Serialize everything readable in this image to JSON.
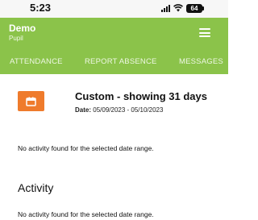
{
  "status_bar": {
    "time": "5:23",
    "battery": "64"
  },
  "header": {
    "title": "Demo",
    "subtitle": "Pupil",
    "menu_icon": "hamburger-menu-icon",
    "background_color": "#8bc34a"
  },
  "tabs": [
    {
      "label": "ATTENDANCE"
    },
    {
      "label": "REPORT ABSENCE"
    },
    {
      "label": "MESSAGES"
    }
  ],
  "date_range": {
    "icon": "calendar-icon",
    "button_color": "#ef7b2c",
    "title": "Custom - showing 31 days",
    "date_label": "Date:",
    "date_value": "05/09/2023 - 05/10/2023"
  },
  "attendance_empty_message": "No activity found for the selected date range.",
  "activity": {
    "heading": "Activity",
    "empty_message": "No activity found for the selected date range."
  }
}
